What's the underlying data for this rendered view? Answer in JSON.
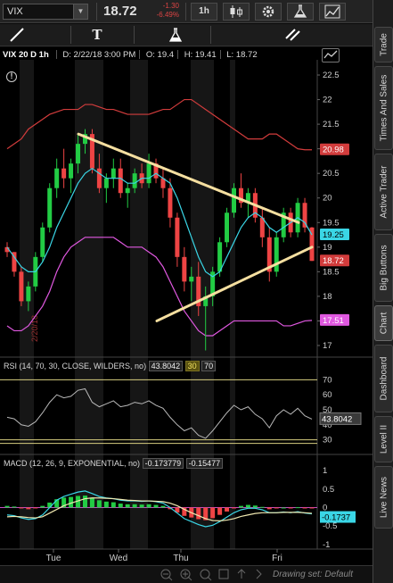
{
  "toolbar": {
    "symbol": "VIX",
    "price": "18.72",
    "change": "-1.30",
    "change_pct": "-6.49%",
    "interval_label": "1h"
  },
  "chart_header": {
    "symbol_interval": "VIX 20 D 1h",
    "date": "D: 2/22/18 3:00 PM",
    "open": "O: 19.4",
    "high": "H: 19.41",
    "low": "L: 18.72"
  },
  "price_axis": {
    "ticks": [
      "22.5",
      "22",
      "21.5",
      "21",
      "20.5",
      "20",
      "19.5",
      "19",
      "18.5",
      "18",
      "17.5",
      "17"
    ],
    "badges": [
      {
        "text": "20.98",
        "color": "#d23c3c"
      },
      {
        "text": "19.25",
        "color": "#3ad6e6"
      },
      {
        "text": "18.72",
        "color": "#d23c3c"
      },
      {
        "text": "17.51",
        "color": "#e058e0"
      }
    ]
  },
  "vertical_date_label": "2/20/18",
  "rsi": {
    "label": "RSI (14, 70, 30, CLOSE, WILDERS, no)",
    "value": "43.8042",
    "low": "30",
    "high": "70",
    "ticks": [
      "70",
      "60",
      "50",
      "40",
      "30"
    ],
    "badge": "43.8042"
  },
  "macd": {
    "label": "MACD (12, 26, 9, EXPONENTIAL, no)",
    "value": "-0.173779",
    "avg": "-0.15477",
    "ticks": [
      "1",
      "0.5",
      "0",
      "-0.5",
      "-1"
    ],
    "badge": "-0.1737"
  },
  "x_axis": [
    "Tue",
    "Wed",
    "Thu",
    "Fri"
  ],
  "bottom": {
    "drawing_set": "Drawing set: Default"
  },
  "right_tabs": [
    "Trade",
    "Times And Sales",
    "Active Trader",
    "Big Buttons",
    "Chart",
    "Dashboard",
    "Level II",
    "Live News"
  ],
  "colors": {
    "up": "#22cc44",
    "down": "#ee4444",
    "trendline": "#f5dfa0",
    "ma_fast": "#3ad6e6",
    "band_upper": "#d23c3c",
    "band_lower": "#e058e0",
    "macd_avg": "#f0e8b0"
  },
  "chart_data": {
    "type": "candlestick",
    "y_range": [
      16.8,
      22.7
    ],
    "candles": [
      [
        19.0,
        19.1,
        18.8,
        18.9
      ],
      [
        18.9,
        18.9,
        18.4,
        18.5
      ],
      [
        18.5,
        18.6,
        17.8,
        17.9
      ],
      [
        17.9,
        18.3,
        17.7,
        18.2
      ],
      [
        18.2,
        18.9,
        18.1,
        18.8
      ],
      [
        18.8,
        19.5,
        18.7,
        19.4
      ],
      [
        19.4,
        20.3,
        19.3,
        20.2
      ],
      [
        20.2,
        20.8,
        20.0,
        20.6
      ],
      [
        20.6,
        21.0,
        20.2,
        20.4
      ],
      [
        20.4,
        20.8,
        20.1,
        20.7
      ],
      [
        20.7,
        21.3,
        20.5,
        21.1
      ],
      [
        21.1,
        21.4,
        20.9,
        21.3
      ],
      [
        21.3,
        21.4,
        20.5,
        20.6
      ],
      [
        20.6,
        20.9,
        20.1,
        20.2
      ],
      [
        20.2,
        20.5,
        19.9,
        20.4
      ],
      [
        20.4,
        20.8,
        20.2,
        20.6
      ],
      [
        20.6,
        20.8,
        20.0,
        20.1
      ],
      [
        20.1,
        20.3,
        19.8,
        20.2
      ],
      [
        20.2,
        20.6,
        20.1,
        20.5
      ],
      [
        20.5,
        20.7,
        20.2,
        20.3
      ],
      [
        20.3,
        20.9,
        20.2,
        20.7
      ],
      [
        20.7,
        20.8,
        20.3,
        20.4
      ],
      [
        20.4,
        20.6,
        20.0,
        20.2
      ],
      [
        20.2,
        20.4,
        19.4,
        19.6
      ],
      [
        19.6,
        19.7,
        18.6,
        18.8
      ],
      [
        18.8,
        19.0,
        18.1,
        18.3
      ],
      [
        18.3,
        18.6,
        17.9,
        18.4
      ],
      [
        18.4,
        18.7,
        17.6,
        17.8
      ],
      [
        17.8,
        18.2,
        16.9,
        18.0
      ],
      [
        18.0,
        18.6,
        17.8,
        18.5
      ],
      [
        18.5,
        19.2,
        18.4,
        19.1
      ],
      [
        19.1,
        19.8,
        19.0,
        19.7
      ],
      [
        19.7,
        20.3,
        19.6,
        20.2
      ],
      [
        20.2,
        20.5,
        19.8,
        19.9
      ],
      [
        19.9,
        20.2,
        19.6,
        20.1
      ],
      [
        20.1,
        20.2,
        19.5,
        19.6
      ],
      [
        19.6,
        19.8,
        19.0,
        19.2
      ],
      [
        19.2,
        19.4,
        18.3,
        18.5
      ],
      [
        18.5,
        19.3,
        18.4,
        19.2
      ],
      [
        19.2,
        19.8,
        19.1,
        19.7
      ],
      [
        19.7,
        19.8,
        19.2,
        19.3
      ],
      [
        19.3,
        20.0,
        19.2,
        19.9
      ],
      [
        19.9,
        20.0,
        19.3,
        19.4
      ],
      [
        19.4,
        19.41,
        18.72,
        18.72
      ]
    ],
    "trendlines": [
      {
        "x1": 0,
        "y1": 21.3,
        "x2": 1,
        "y2": 19.5
      },
      {
        "x1": 0,
        "y1": 17.5,
        "x2": 1,
        "y2": 19.0
      }
    ],
    "ma_fast": [
      19.0,
      18.8,
      18.6,
      18.5,
      18.5,
      18.7,
      19.0,
      19.4,
      19.7,
      20.0,
      20.3,
      20.5,
      20.6,
      20.5,
      20.4,
      20.4,
      20.4,
      20.3,
      20.3,
      20.4,
      20.4,
      20.5,
      20.4,
      20.3,
      20.0,
      19.6,
      19.2,
      18.8,
      18.5,
      18.4,
      18.5,
      18.8,
      19.1,
      19.4,
      19.6,
      19.7,
      19.6,
      19.4,
      19.3,
      19.4,
      19.5,
      19.6,
      19.5,
      19.25
    ],
    "band_upper": [
      21.0,
      21.1,
      21.2,
      21.4,
      21.5,
      21.6,
      21.7,
      21.75,
      21.8,
      21.8,
      21.8,
      21.9,
      21.9,
      21.85,
      21.8,
      21.8,
      21.75,
      21.7,
      21.7,
      21.7,
      21.7,
      21.75,
      21.8,
      21.8,
      21.9,
      22.0,
      22.0,
      21.9,
      21.8,
      21.7,
      21.6,
      21.5,
      21.4,
      21.3,
      21.2,
      21.2,
      21.2,
      21.3,
      21.3,
      21.2,
      21.1,
      21.0,
      20.98,
      20.98
    ],
    "band_lower": [
      17.4,
      17.3,
      17.3,
      17.4,
      17.6,
      17.8,
      18.1,
      18.5,
      18.8,
      19.0,
      19.1,
      19.2,
      19.2,
      19.2,
      19.2,
      19.2,
      19.1,
      19.0,
      19.0,
      19.0,
      18.9,
      18.8,
      18.6,
      18.3,
      18.0,
      17.7,
      17.5,
      17.3,
      17.2,
      17.2,
      17.3,
      17.4,
      17.5,
      17.5,
      17.5,
      17.5,
      17.5,
      17.5,
      17.5,
      17.4,
      17.4,
      17.45,
      17.5,
      17.51
    ],
    "rsi": [
      45,
      44,
      40,
      39,
      42,
      48,
      55,
      60,
      58,
      59,
      63,
      64,
      55,
      52,
      54,
      56,
      52,
      53,
      55,
      54,
      56,
      53,
      51,
      45,
      40,
      36,
      38,
      33,
      31,
      36,
      42,
      48,
      53,
      50,
      52,
      47,
      44,
      38,
      46,
      50,
      47,
      51,
      46,
      43.8
    ],
    "macd_hist": [
      0.05,
      0.03,
      -0.02,
      -0.05,
      -0.02,
      0.05,
      0.15,
      0.25,
      0.3,
      0.32,
      0.35,
      0.36,
      0.3,
      0.22,
      0.18,
      0.16,
      0.12,
      0.1,
      0.1,
      0.09,
      0.1,
      0.08,
      0.05,
      -0.05,
      -0.15,
      -0.25,
      -0.3,
      -0.35,
      -0.38,
      -0.32,
      -0.22,
      -0.12,
      -0.02,
      0.05,
      0.08,
      0.06,
      0.02,
      -0.05,
      -0.02,
      0.0,
      -0.02,
      0.01,
      -0.02,
      -0.02
    ],
    "macd_line": [
      -0.2,
      -0.22,
      -0.28,
      -0.32,
      -0.3,
      -0.2,
      0.0,
      0.2,
      0.3,
      0.36,
      0.42,
      0.45,
      0.38,
      0.3,
      0.26,
      0.24,
      0.2,
      0.18,
      0.18,
      0.17,
      0.18,
      0.16,
      0.12,
      0.0,
      -0.15,
      -0.3,
      -0.38,
      -0.46,
      -0.52,
      -0.48,
      -0.38,
      -0.26,
      -0.14,
      -0.06,
      -0.02,
      -0.02,
      -0.06,
      -0.14,
      -0.14,
      -0.12,
      -0.14,
      -0.11,
      -0.15,
      -0.17
    ],
    "macd_avg": [
      -0.25,
      -0.24,
      -0.25,
      -0.27,
      -0.28,
      -0.25,
      -0.15,
      -0.05,
      0.05,
      0.12,
      0.18,
      0.24,
      0.26,
      0.26,
      0.25,
      0.24,
      0.22,
      0.2,
      0.19,
      0.18,
      0.18,
      0.17,
      0.16,
      0.12,
      0.05,
      -0.05,
      -0.14,
      -0.22,
      -0.3,
      -0.35,
      -0.36,
      -0.34,
      -0.3,
      -0.24,
      -0.2,
      -0.16,
      -0.14,
      -0.14,
      -0.14,
      -0.13,
      -0.13,
      -0.13,
      -0.14,
      -0.155
    ]
  }
}
